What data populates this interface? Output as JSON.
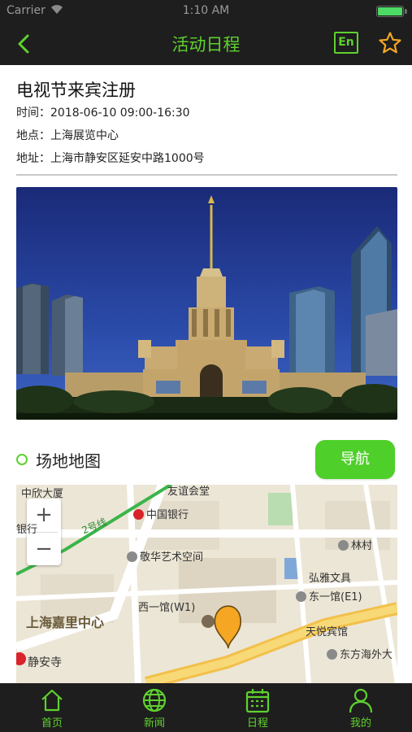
{
  "status_bar": {
    "carrier": "Carrier",
    "time": "1:10 AM"
  },
  "nav": {
    "title": "活动日程",
    "lang_button": "En"
  },
  "event": {
    "title": "电视节来宾注册",
    "time_line": "时间：2018-06-10 09:00-16:30",
    "place_line": "地点：上海展览中心",
    "address_line": "地址：上海市静安区延安中路1000号"
  },
  "map_section": {
    "title": "场地地图",
    "navigate_button": "导航",
    "labels": {
      "zhongxin": "中欣大厦",
      "youyi": "友谊会堂",
      "zhongguo_bank": "中国银行",
      "bank_left": "银行",
      "line2": "2号线",
      "jinghua": "敬华艺术空间",
      "linchun": "林村",
      "hongya": "弘雅文具",
      "dongyiguan": "东一馆(E1)",
      "xiyiguan": "西一馆(W1)",
      "jiali": "上海嘉里中心",
      "tianyue": "天悦宾馆",
      "dongfang": "东方海外大",
      "jingan": "静安寺"
    },
    "zoom_in": "+",
    "zoom_out": "−"
  },
  "tabs": [
    {
      "label": "首页",
      "icon": "home-icon"
    },
    {
      "label": "新闻",
      "icon": "globe-icon"
    },
    {
      "label": "日程",
      "icon": "calendar-icon"
    },
    {
      "label": "我的",
      "icon": "user-icon"
    }
  ],
  "colors": {
    "accent": "#5fd12e",
    "bar_bg": "#1e1e1e",
    "button": "#4fcf29",
    "marker": "#f5a623"
  }
}
